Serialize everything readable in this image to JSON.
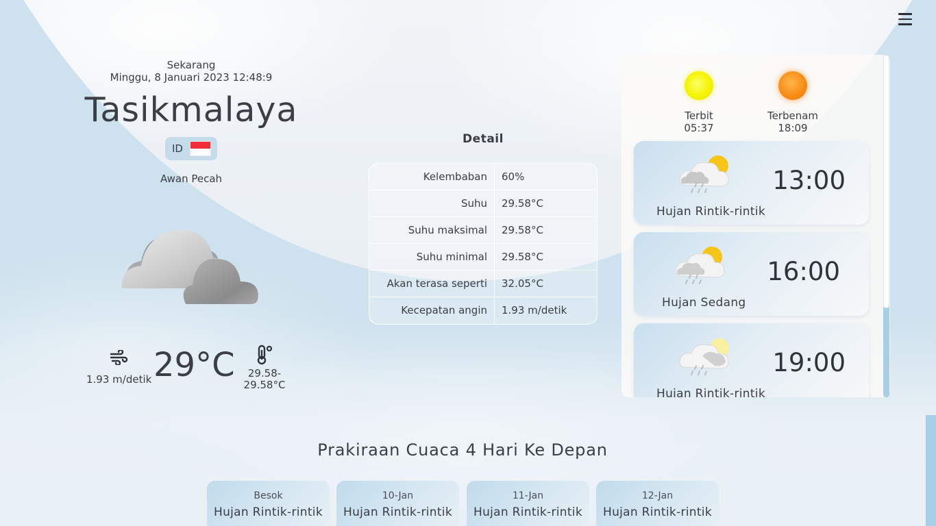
{
  "header": {
    "menu_icon": "hamburger-menu-icon"
  },
  "current": {
    "now_label": "Sekarang",
    "datetime": "Minggu, 8 Januari 2023 12:48:9",
    "city": "Tasikmalaya",
    "country_code": "ID",
    "flag_icon": "indonesia-flag-icon",
    "condition": "Awan Pecah",
    "condition_icon": "broken-clouds-icon",
    "wind_speed": "1.93 m/detik",
    "wind_icon": "wind-icon",
    "temperature": "29°C",
    "temp_range": "29.58-29.58°C",
    "thermometer_icon": "thermometer-icon"
  },
  "detail": {
    "title": "Detail",
    "rows": [
      {
        "label": "Kelembaban",
        "value": "60%"
      },
      {
        "label": "Suhu",
        "value": "29.58°C"
      },
      {
        "label": "Suhu maksimal",
        "value": "29.58°C"
      },
      {
        "label": "Suhu minimal",
        "value": "29.58°C"
      },
      {
        "label": "Akan terasa seperti",
        "value": "32.05°C"
      },
      {
        "label": "Kecepatan angin",
        "value": "1.93 m/detik"
      }
    ]
  },
  "sun": {
    "sunrise_label": "Terbit",
    "sunrise_time": "05:37",
    "sunset_label": "Terbenam",
    "sunset_time": "18:09",
    "colors": {
      "sunrise": "#f5f300",
      "sunset": "#f88a12"
    }
  },
  "hourly": [
    {
      "time": "13:00",
      "desc": "Hujan Rintik-rintik",
      "icon": "light-rain-sun-icon"
    },
    {
      "time": "16:00",
      "desc": "Hujan Sedang",
      "icon": "moderate-rain-sun-icon"
    },
    {
      "time": "19:00",
      "desc": "Hujan Rintik-rintik",
      "icon": "light-rain-sun-icon"
    }
  ],
  "forecast": {
    "title": "Prakiraan Cuaca 4 Hari Ke Depan",
    "days": [
      {
        "day": "Besok",
        "desc": "Hujan Rintik-rintik"
      },
      {
        "day": "10-Jan",
        "desc": "Hujan Rintik-rintik"
      },
      {
        "day": "11-Jan",
        "desc": "Hujan Rintik-rintik"
      },
      {
        "day": "12-Jan",
        "desc": "Hujan Rintik-rintik"
      }
    ]
  },
  "colors": {
    "accent": "#a8cfe8",
    "text": "#3a3d45"
  }
}
